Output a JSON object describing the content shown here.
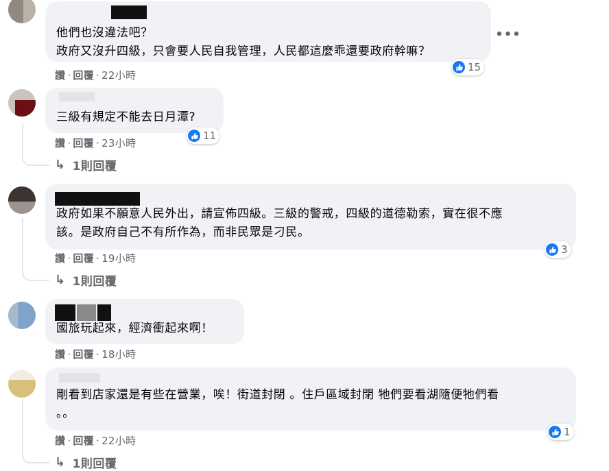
{
  "comments": [
    {
      "text": "他們也沒違法吧？\n政府又沒升四級，只會要人民自我管理，人民都這麼乖還要政府幹嘛？",
      "actions": {
        "like": "讚",
        "reply": "回覆",
        "sep": "·",
        "time": "22小時"
      },
      "reactions": "15",
      "more_icon": "more-horizontal-icon"
    },
    {
      "text": "三級有規定不能去日月潭?",
      "actions": {
        "like": "讚",
        "reply": "回覆",
        "sep": "·",
        "time": "23小時"
      },
      "reactions": "11",
      "replies": "1則回覆"
    },
    {
      "text": "政府如果不願意人民外出，請宣佈四級。三級的警戒，四級的道德勒索，實在很不應\n該。是政府自己不有所作為，而非民眾是刁民。",
      "actions": {
        "like": "讚",
        "reply": "回覆",
        "sep": "·",
        "time": "19小時"
      },
      "reactions": "3",
      "replies": "1則回覆"
    },
    {
      "text": "國旅玩起來，經濟衝起來啊！",
      "actions": {
        "like": "讚",
        "reply": "回覆",
        "sep": "·",
        "time": "18小時"
      }
    },
    {
      "text": "剛看到店家還是有些在營業，唉！街道封閉 。住戶區域封閉 牠們要看湖隨便牠們看\n。。",
      "actions": {
        "like": "讚",
        "reply": "回覆",
        "sep": "·",
        "time": "22小時"
      },
      "reactions": "1",
      "replies": "1則回覆"
    }
  ],
  "colors": {
    "bubble": "#f0f2f5",
    "like_blue": "#1877f2",
    "meta_grey": "#65676b"
  }
}
